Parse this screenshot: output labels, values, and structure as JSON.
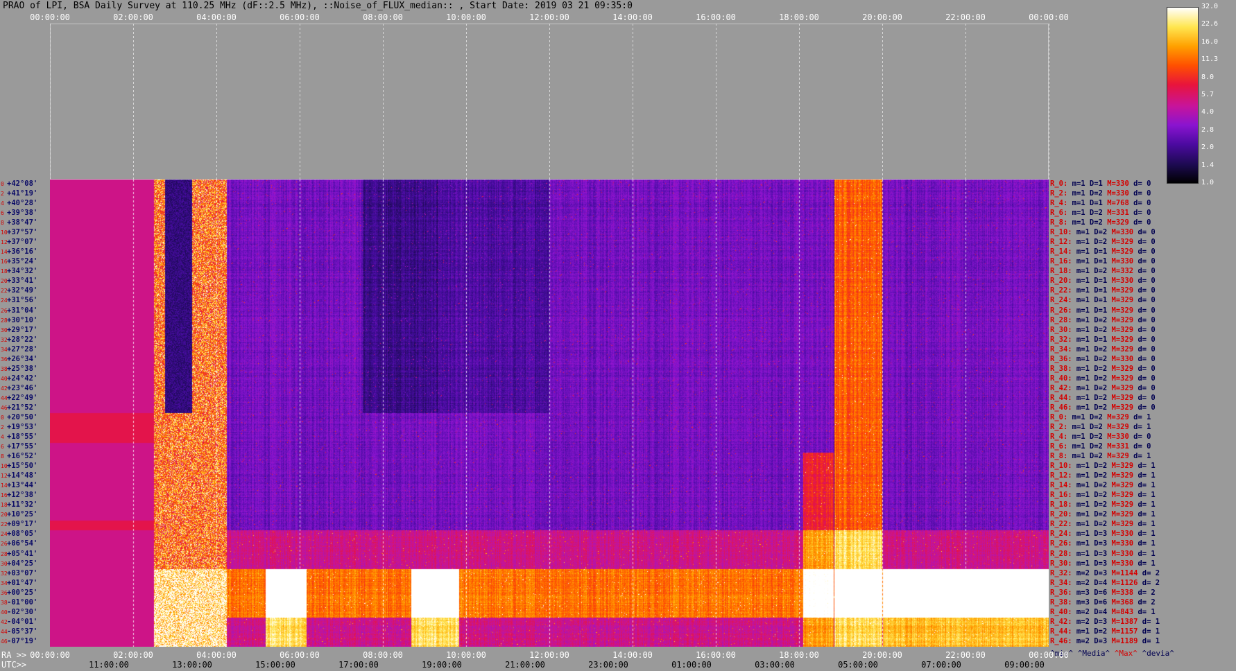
{
  "title": "PRAO of LPI, BSA Daily Survey at 110.25 MHz (dF::2.5 MHz), ::Noise_of_FLUX_median:: , Start Date: 2019 03 21 09:35:0",
  "ra_prefix": "RA >>",
  "utc_prefix": "UTC>>",
  "ra_ticks_top": [
    "00:00:00",
    "02:00:00",
    "04:00:00",
    "06:00:00",
    "08:00:00",
    "10:00:00",
    "12:00:00",
    "14:00:00",
    "16:00:00",
    "18:00:00",
    "20:00:00",
    "22:00:00",
    "00:00:00"
  ],
  "ra_ticks_bottom": [
    "00:00:00",
    "02:00:00",
    "04:00:00",
    "06:00:00",
    "08:00:00",
    "10:00:00",
    "12:00:00",
    "14:00:00",
    "16:00:00",
    "18:00:00",
    "20:00:00",
    "22:00:00",
    "00:00:00"
  ],
  "utc_ticks": [
    "11:00:00",
    "13:00:00",
    "15:00:00",
    "17:00:00",
    "19:00:00",
    "21:00:00",
    "23:00:00",
    "01:00:00",
    "03:00:00",
    "05:00:00",
    "07:00:00",
    "09:00:00"
  ],
  "colorbar_ticks": [
    "32.0",
    "22.6",
    "16.0",
    "11.3",
    "8.0",
    "5.7",
    "4.0",
    "2.8",
    "2.0",
    "1.4",
    "1.0"
  ],
  "legend": {
    "min": "^min^",
    "media": "^Media^",
    "max": "^Max^",
    "devia": "^devia^"
  },
  "colors": {
    "background": "#9a9a9a",
    "stat_red": "#d40000",
    "stat_dark": "#000050",
    "dec_label": "#0a0a66"
  },
  "chart_data": {
    "type": "heatmap",
    "title": "PRAO of LPI, BSA Daily Survey at 110.25 MHz (dF::2.5 MHz), ::Noise_of_FLUX_median:: , Start Date: 2019 03 21 09:35:0",
    "xlabel": "RA / UTC",
    "ylabel": "",
    "colorscale_range": [
      1.0,
      32.0
    ],
    "declinations": [
      "+42°08'",
      "+41°19'",
      "+40°28'",
      "+39°38'",
      "+38°47'",
      "+37°57'",
      "+37°07'",
      "+36°16'",
      "+35°24'",
      "+34°32'",
      "+33°41'",
      "+32°49'",
      "+31°56'",
      "+31°04'",
      "+30°10'",
      "+29°17'",
      "+28°22'",
      "+27°28'",
      "+26°34'",
      "+25°38'",
      "+24°42'",
      "+23°46'",
      "+22°49'",
      "+21°52'",
      "+20°50'",
      "+19°53'",
      "+18°55'",
      "+17°55'",
      "+16°52'",
      "+15°50'",
      "+14°48'",
      "+13°44'",
      "+12°38'",
      "+11°32'",
      "+10°25'",
      "+09°17'",
      "+08°05'",
      "+06°54'",
      "+05°41'",
      "+04°25'",
      "+03°07'",
      "+01°47'",
      "+00°25'",
      "-01°00'",
      "-02°30'",
      "-04°01'",
      "-05°37'",
      "-07°19'"
    ],
    "row_numbers": [
      "0",
      "2",
      "4",
      "6",
      "8",
      "10",
      "12",
      "14",
      "16",
      "18",
      "20",
      "22",
      "24",
      "26",
      "28",
      "30",
      "32",
      "34",
      "36",
      "38",
      "40",
      "42",
      "44",
      "46",
      "0",
      "2",
      "4",
      "6",
      "8",
      "10",
      "12",
      "14",
      "16",
      "18",
      "20",
      "22",
      "24",
      "26",
      "28",
      "30",
      "32",
      "34",
      "36",
      "38",
      "40",
      "42",
      "44",
      "46"
    ],
    "row_stats": [
      {
        "r": "R_0:",
        "m": "m=1",
        "D": "D=1",
        "M": "M=330",
        "d": "d= 0"
      },
      {
        "r": "R_2:",
        "m": "m=1",
        "D": "D=2",
        "M": "M=330",
        "d": "d= 0"
      },
      {
        "r": "R_4:",
        "m": "m=1",
        "D": "D=1",
        "M": "M=768",
        "d": "d= 0"
      },
      {
        "r": "R_6:",
        "m": "m=1",
        "D": "D=2",
        "M": "M=331",
        "d": "d= 0"
      },
      {
        "r": "R_8:",
        "m": "m=1",
        "D": "D=2",
        "M": "M=329",
        "d": "d= 0"
      },
      {
        "r": "R_10:",
        "m": "m=1",
        "D": "D=2",
        "M": "M=330",
        "d": "d= 0"
      },
      {
        "r": "R_12:",
        "m": "m=1",
        "D": "D=2",
        "M": "M=329",
        "d": "d= 0"
      },
      {
        "r": "R_14:",
        "m": "m=1",
        "D": "D=1",
        "M": "M=329",
        "d": "d= 0"
      },
      {
        "r": "R_16:",
        "m": "m=1",
        "D": "D=1",
        "M": "M=330",
        "d": "d= 0"
      },
      {
        "r": "R_18:",
        "m": "m=1",
        "D": "D=2",
        "M": "M=332",
        "d": "d= 0"
      },
      {
        "r": "R_20:",
        "m": "m=1",
        "D": "D=1",
        "M": "M=330",
        "d": "d= 0"
      },
      {
        "r": "R_22:",
        "m": "m=1",
        "D": "D=1",
        "M": "M=329",
        "d": "d= 0"
      },
      {
        "r": "R_24:",
        "m": "m=1",
        "D": "D=1",
        "M": "M=329",
        "d": "d= 0"
      },
      {
        "r": "R_26:",
        "m": "m=1",
        "D": "D=1",
        "M": "M=329",
        "d": "d= 0"
      },
      {
        "r": "R_28:",
        "m": "m=1",
        "D": "D=2",
        "M": "M=329",
        "d": "d= 0"
      },
      {
        "r": "R_30:",
        "m": "m=1",
        "D": "D=2",
        "M": "M=329",
        "d": "d= 0"
      },
      {
        "r": "R_32:",
        "m": "m=1",
        "D": "D=1",
        "M": "M=329",
        "d": "d= 0"
      },
      {
        "r": "R_34:",
        "m": "m=1",
        "D": "D=2",
        "M": "M=329",
        "d": "d= 0"
      },
      {
        "r": "R_36:",
        "m": "m=1",
        "D": "D=2",
        "M": "M=330",
        "d": "d= 0"
      },
      {
        "r": "R_38:",
        "m": "m=1",
        "D": "D=2",
        "M": "M=329",
        "d": "d= 0"
      },
      {
        "r": "R_40:",
        "m": "m=1",
        "D": "D=2",
        "M": "M=329",
        "d": "d= 0"
      },
      {
        "r": "R_42:",
        "m": "m=1",
        "D": "D=2",
        "M": "M=329",
        "d": "d= 0"
      },
      {
        "r": "R_44:",
        "m": "m=1",
        "D": "D=2",
        "M": "M=329",
        "d": "d= 0"
      },
      {
        "r": "R_46:",
        "m": "m=1",
        "D": "D=2",
        "M": "M=329",
        "d": "d= 0"
      },
      {
        "r": "R_0:",
        "m": "m=1",
        "D": "D=2",
        "M": "M=329",
        "d": "d= 1"
      },
      {
        "r": "R_2:",
        "m": "m=1",
        "D": "D=2",
        "M": "M=329",
        "d": "d= 1"
      },
      {
        "r": "R_4:",
        "m": "m=1",
        "D": "D=2",
        "M": "M=330",
        "d": "d= 0"
      },
      {
        "r": "R_6:",
        "m": "m=1",
        "D": "D=2",
        "M": "M=331",
        "d": "d= 0"
      },
      {
        "r": "R_8:",
        "m": "m=1",
        "D": "D=2",
        "M": "M=329",
        "d": "d= 1"
      },
      {
        "r": "R_10:",
        "m": "m=1",
        "D": "D=2",
        "M": "M=329",
        "d": "d= 1"
      },
      {
        "r": "R_12:",
        "m": "m=1",
        "D": "D=2",
        "M": "M=329",
        "d": "d= 1"
      },
      {
        "r": "R_14:",
        "m": "m=1",
        "D": "D=2",
        "M": "M=329",
        "d": "d= 1"
      },
      {
        "r": "R_16:",
        "m": "m=1",
        "D": "D=2",
        "M": "M=329",
        "d": "d= 1"
      },
      {
        "r": "R_18:",
        "m": "m=1",
        "D": "D=2",
        "M": "M=329",
        "d": "d= 1"
      },
      {
        "r": "R_20:",
        "m": "m=1",
        "D": "D=2",
        "M": "M=329",
        "d": "d= 1"
      },
      {
        "r": "R_22:",
        "m": "m=1",
        "D": "D=2",
        "M": "M=329",
        "d": "d= 1"
      },
      {
        "r": "R_24:",
        "m": "m=1",
        "D": "D=3",
        "M": "M=330",
        "d": "d= 1"
      },
      {
        "r": "R_26:",
        "m": "m=1",
        "D": "D=3",
        "M": "M=330",
        "d": "d= 1"
      },
      {
        "r": "R_28:",
        "m": "m=1",
        "D": "D=3",
        "M": "M=330",
        "d": "d= 1"
      },
      {
        "r": "R_30:",
        "m": "m=1",
        "D": "D=3",
        "M": "M=330",
        "d": "d= 1"
      },
      {
        "r": "R_32:",
        "m": "m=2",
        "D": "D=3",
        "M": "M=1144",
        "d": "d= 2"
      },
      {
        "r": "R_34:",
        "m": "m=2",
        "D": "D=4",
        "M": "M=1126",
        "d": "d= 2"
      },
      {
        "r": "R_36:",
        "m": "m=3",
        "D": "D=6",
        "M": "M=338",
        "d": "d= 2"
      },
      {
        "r": "R_38:",
        "m": "m=3",
        "D": "D=6",
        "M": "M=368",
        "d": "d= 2"
      },
      {
        "r": "R_40:",
        "m": "m=2",
        "D": "D=4",
        "M": "M=843",
        "d": "d= 1"
      },
      {
        "r": "R_42:",
        "m": "m=2",
        "D": "D=3",
        "M": "M=1387",
        "d": "d= 1"
      },
      {
        "r": "R_44:",
        "m": "m=1",
        "D": "D=2",
        "M": "M=1157",
        "d": "d= 1"
      },
      {
        "r": "R_46:",
        "m": "m=2",
        "D": "D=3",
        "M": "M=1189",
        "d": "d= 1"
      }
    ]
  }
}
